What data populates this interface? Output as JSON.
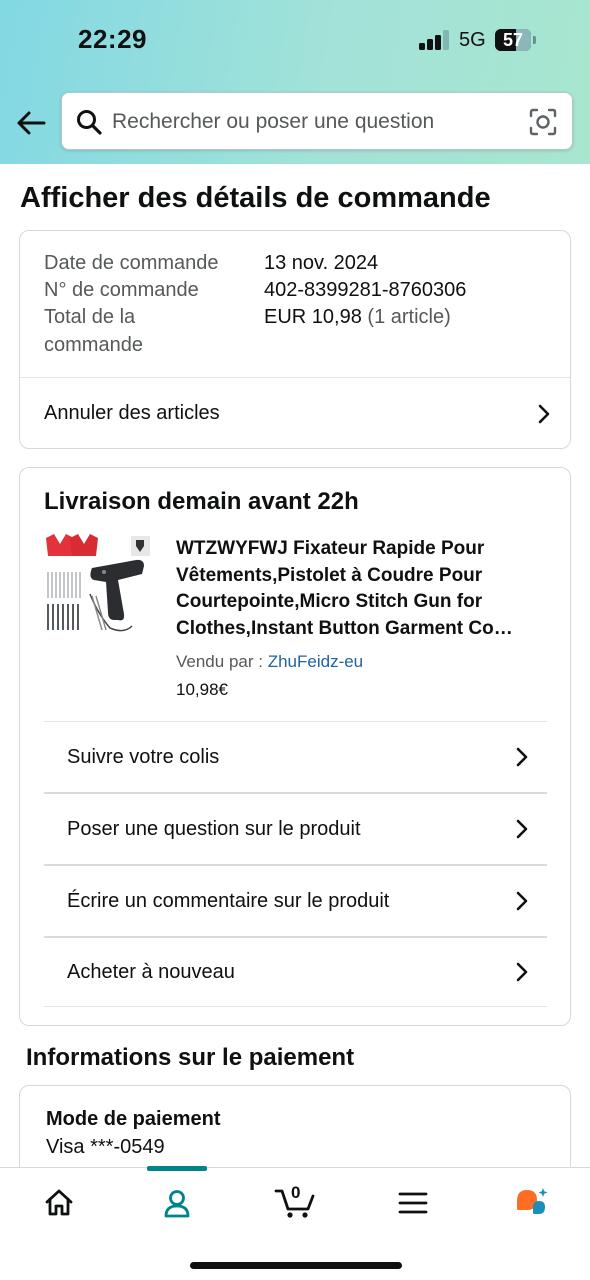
{
  "status_bar": {
    "time": "22:29",
    "network": "5G",
    "battery": "57",
    "battery_level": 0.57
  },
  "search": {
    "placeholder": "Rechercher ou poser une question"
  },
  "page": {
    "title": "Afficher des détails de commande"
  },
  "order_summary": {
    "date_label": "Date de commande",
    "date_value": "13 nov. 2024",
    "number_label": "N° de commande",
    "number_value": "402-8399281-8760306",
    "total_label_line1": "Total de la",
    "total_label_line2": "commande",
    "total_amount": "EUR 10,98",
    "total_items": "(1 article)",
    "cancel_label": "Annuler des articles"
  },
  "delivery": {
    "title": "Livraison demain avant 22h",
    "product": {
      "title": "WTZWYFWJ Fixateur Rapide Pour Vêtements,Pistolet à Coudre Pour Courtepointe,Micro Stitch Gun for Clothes,Instant Button Garment Co…",
      "seller_prefix": "Vendu par  :",
      "seller_name": "ZhuFeidz-eu",
      "price": "10,98€"
    },
    "actions": [
      {
        "label": "Suivre votre colis"
      },
      {
        "label": "Poser une question sur le produit"
      },
      {
        "label": "Écrire un commentaire sur le produit"
      },
      {
        "label": "Acheter à nouveau"
      }
    ]
  },
  "payment": {
    "section_title": "Informations sur le paiement",
    "method_label": "Mode de paiement",
    "method_value": "Visa  ***-0549"
  },
  "bottom_nav": {
    "cart_count": "0",
    "items": [
      {
        "icon": "home-icon"
      },
      {
        "icon": "account-icon",
        "active": true
      },
      {
        "icon": "cart-icon"
      },
      {
        "icon": "menu-icon"
      },
      {
        "icon": "rufus-assistant-icon"
      }
    ]
  },
  "colors": {
    "accent": "#00838a",
    "link": "#2162a1",
    "text": "#0f1111",
    "muted": "#565959"
  }
}
